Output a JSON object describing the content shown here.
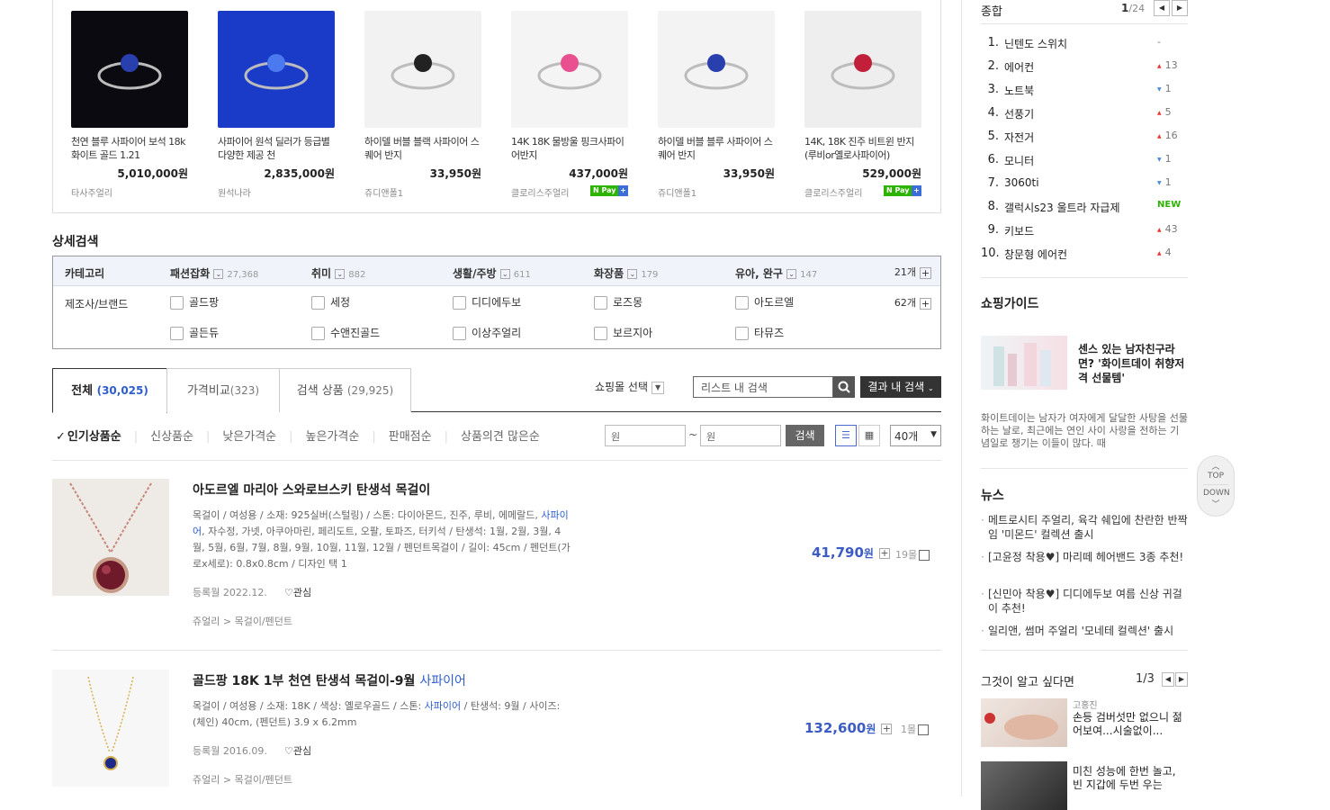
{
  "top_products": [
    {
      "name": "천연 블루 사파이어 보석 18k 화이트 골드 1.21",
      "price": "5,010,000원",
      "shop": "타사주얼리",
      "npay": false,
      "img_color": "#0a0a10",
      "gem": "#2a3fae"
    },
    {
      "name": "사파이어 원석 딜러가 등급별 다양한 제공 천",
      "price": "2,835,000원",
      "shop": "원석나라",
      "npay": false,
      "img_color": "#1a3ac8",
      "gem": "#4a79f0"
    },
    {
      "name": "하이델 버블 블랙 사파이어 스퀘어 반지",
      "price": "33,950원",
      "shop": "쥬디앤폴1",
      "npay": false,
      "img_color": "#f2f2f2",
      "gem": "#222"
    },
    {
      "name": "14K 18K 물방울 핑크사파이어반지",
      "price": "437,000원",
      "shop": "클로리스주얼리",
      "npay": true,
      "img_color": "#f4f4f4",
      "gem": "#e8508f"
    },
    {
      "name": "하이델 버블 블루 사파이어 스퀘어 반지",
      "price": "33,950원",
      "shop": "쥬디앤폴1",
      "npay": false,
      "img_color": "#f3f3f3",
      "gem": "#2a3fae"
    },
    {
      "name": "14K, 18K 진주 비트윈 반지(루비or옐로사파이어)",
      "price": "529,000원",
      "shop": "클로리스주얼리",
      "npay": true,
      "img_color": "#eeeeef",
      "gem": "#c2203a"
    }
  ],
  "npay_label": "N Pay",
  "detail": {
    "title": "상세검색",
    "category_label": "카테고리",
    "categories": [
      {
        "name": "패션잡화",
        "count": "27,368"
      },
      {
        "name": "취미",
        "count": "882"
      },
      {
        "name": "생활/주방",
        "count": "611"
      },
      {
        "name": "화장품",
        "count": "179"
      },
      {
        "name": "유아, 완구",
        "count": "147"
      }
    ],
    "category_total": "21개",
    "brand_label": "제조사/브랜드",
    "brands_row1": [
      "골드팡",
      "세정",
      "디디에두보",
      "로즈몽",
      "아도르엘"
    ],
    "brands_row2": [
      "골든듀",
      "수앤진골드",
      "이상주얼리",
      "보르지아",
      "타뮤즈"
    ],
    "brand_total": "62개"
  },
  "tabs": [
    {
      "label": "전체",
      "count": "(30,025)"
    },
    {
      "label": "가격비교",
      "count": "(323)"
    },
    {
      "label": "검색 상품",
      "count": "(29,925)"
    }
  ],
  "mall_select": "쇼핑몰 선택",
  "search_placeholder": "리스트 내 검색",
  "result_search_btn": "결과 내 검색",
  "sort": [
    "인기상품순",
    "신상품순",
    "낮은가격순",
    "높은가격순",
    "판매점순",
    "상품의견 많은순"
  ],
  "price_from_placeholder": "원",
  "price_to_placeholder": "원",
  "price_search_btn": "검색",
  "count_select": "40개",
  "items": [
    {
      "title": "아도르엘 마리아 스와로브스키 탄생석 목걸이",
      "title_hl": "",
      "desc_a": "목걸이 / 여성용 / 소재: 925실버(스털링) / 스톤: 다이아몬드, 진주, 루비, 에메랄드, ",
      "desc_hl": "사파이어",
      "desc_b": ", 자수정, 가넷, 아쿠아마린, 페리도트, 오팔, 토파즈, 터키석 / 탄생석: 1월, 2월, 3월, 4월, 5월, 6월, 7월, 8월, 9월, 10월, 11월, 12월 / 펜던트목걸이 / 길이: 45cm / 펜던트(가로x세로): 0.8x0.8cm / 디자인 택 1",
      "reg": "등록월 2022.12.",
      "like": "관심",
      "cat1": "쥬얼리",
      "cat2": "목걸이/펜던트",
      "price": "41,790",
      "won": "원",
      "month": "19몰"
    },
    {
      "title": "골드팡 18K 1부 천연 탄생석 목걸이-9월 ",
      "title_hl": "사파이어",
      "desc_a": "목걸이 / 여성용 / 소재: 18K / 색상: 옐로우골드 / 스톤: ",
      "desc_hl": "사파이어",
      "desc_b": " / 탄생석: 9월 / 사이즈: (체인) 40cm, (펜던트) 3.9 x 6.2mm",
      "reg": "등록월 2016.09.",
      "like": "관심",
      "cat1": "쥬얼리",
      "cat2": "목걸이/펜던트",
      "price": "132,600",
      "won": "원",
      "month": "1몰"
    }
  ],
  "side": {
    "rank_title": "종합",
    "rank_page": "1",
    "rank_total": "/24",
    "ranks": [
      {
        "n": "1.",
        "t": "닌텐도 스위치",
        "ch": "-",
        "dir": "none"
      },
      {
        "n": "2.",
        "t": "에어컨",
        "ch": "13",
        "dir": "up"
      },
      {
        "n": "3.",
        "t": "노트북",
        "ch": "1",
        "dir": "dn"
      },
      {
        "n": "4.",
        "t": "선풍기",
        "ch": "5",
        "dir": "up"
      },
      {
        "n": "5.",
        "t": "자전거",
        "ch": "16",
        "dir": "up"
      },
      {
        "n": "6.",
        "t": "모니터",
        "ch": "1",
        "dir": "dn"
      },
      {
        "n": "7.",
        "t": "3060ti",
        "ch": "1",
        "dir": "dn"
      },
      {
        "n": "8.",
        "t": "갤럭시s23 울트라 자급제",
        "ch": "NEW",
        "dir": "new"
      },
      {
        "n": "9.",
        "t": "키보드",
        "ch": "43",
        "dir": "up"
      },
      {
        "n": "10.",
        "t": "창문형 에어컨",
        "ch": "4",
        "dir": "up"
      }
    ],
    "guide_title": "쇼핑가이드",
    "guide_text": "센스 있는 남자친구라면? '화이트데이 취향저격 선물템'",
    "guide_desc": "화이트데이는 남자가 여자에게 달달한 사탕을 선물하는 날로, 최근에는 연인 사이 사랑을 전하는 기념일로 챙기는 이들이 많다. 때",
    "news_title": "뉴스",
    "news": [
      "메트로시티 주얼리, 육각 쉐입에 찬란한 반짝임 '미몬드' 컬렉션 출시",
      "[고윤정 착용♥] 마리떼 헤어밴드 3종 추천!",
      "[신민아 착용♥] 디디에두보 여름 신상 귀걸이 추천!",
      "일리앤, 썸머 주얼리 '모네테 컬렉션' 출시"
    ],
    "qa_title": "그것이 알고 싶다면",
    "qa_page": "1/3",
    "qa": [
      {
        "name": "고홍진",
        "text": "손등 검버섯만 없으니 젊어보여...시술없이..."
      },
      {
        "name": "",
        "text": "미친 성능에 한번 놀고, 빈 지갑에 두번 우는"
      }
    ]
  },
  "top_label": "TOP",
  "down_label": "DOWN"
}
